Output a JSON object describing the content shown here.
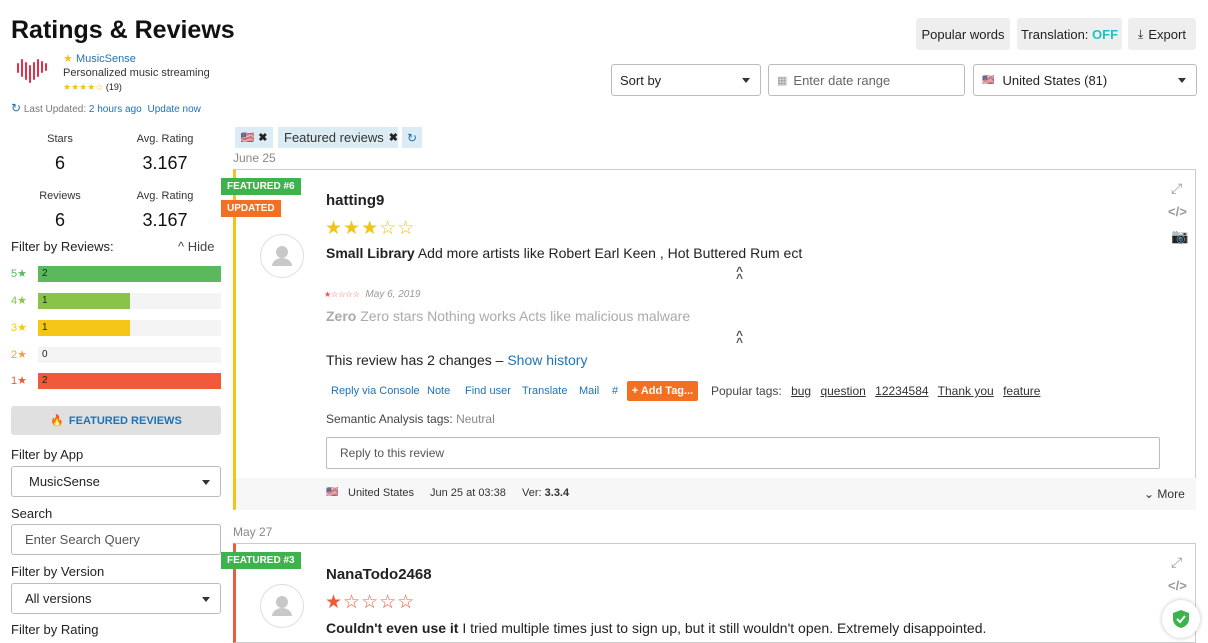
{
  "page": {
    "title": "Ratings & Reviews"
  },
  "app": {
    "name": "MusicSense",
    "subtitle": "Personalized music streaming",
    "stars": "★★★★☆",
    "rating_count": "(19)",
    "last_updated_label": "Last Updated:",
    "last_updated_value": "2 hours ago",
    "update_now": "Update now"
  },
  "toolbar": {
    "popular_words": "Popular words",
    "translation_label": "Translation:",
    "translation_state": "OFF",
    "export": "Export"
  },
  "filters_top": {
    "sort_by": "Sort by",
    "date_placeholder": "Enter date range",
    "country": "United States (81)"
  },
  "chips": {
    "featured": "Featured reviews"
  },
  "stats": {
    "stars_label": "Stars",
    "stars_value": "6",
    "avg1_label": "Avg. Rating",
    "avg1_value": "3.167",
    "reviews_label": "Reviews",
    "reviews_value": "6",
    "avg2_label": "Avg. Rating",
    "avg2_value": "3.167"
  },
  "filter_reviews": {
    "label": "Filter by Reviews:",
    "hide": "Hide",
    "rows": [
      {
        "stars": "5★",
        "count": "2",
        "fraction": 1.0,
        "color": "#5cb85c"
      },
      {
        "stars": "4★",
        "count": "1",
        "fraction": 0.5,
        "color": "#8bc34a"
      },
      {
        "stars": "3★",
        "count": "1",
        "fraction": 0.5,
        "color": "#f5c518"
      },
      {
        "stars": "2★",
        "count": "0",
        "fraction": 0.0,
        "color": "#f4a142"
      },
      {
        "stars": "1★",
        "count": "2",
        "fraction": 1.0,
        "color": "#f05a3a"
      }
    ]
  },
  "sidebar": {
    "featured_button": "FEATURED REVIEWS",
    "filter_app_label": "Filter by App",
    "filter_app_value": "MusicSense",
    "search_label": "Search",
    "search_placeholder": "Enter Search Query",
    "version_label": "Filter by Version",
    "version_value": "All versions",
    "rating_label": "Filter by Rating"
  },
  "reviews": [
    {
      "date_header": "June 25",
      "featured_badge": "FEATURED #6",
      "updated_badge": "UPDATED",
      "author": "hatting9",
      "stars": "★★★☆☆",
      "title": "Small Library",
      "body": "Add more artists like Robert Earl Keen , Hot Buttered Rum ect",
      "old_stars": "★☆☆☆☆",
      "old_date": "May 6, 2019",
      "old_title": "Zero",
      "old_body": "Zero stars Nothing works Acts like malicious malware",
      "changes_text": "This review has 2 changes –",
      "show_history": "Show history",
      "actions": [
        "Reply via Console",
        "Note",
        "Find user",
        "Translate",
        "Mail",
        "#"
      ],
      "add_tag": "+ Add Tag...",
      "popular_tags_label": "Popular tags:",
      "tags": [
        "bug",
        "question",
        "12234584",
        "Thank you",
        "feature"
      ],
      "semantic_label": "Semantic Analysis tags:",
      "semantic_value": "Neutral",
      "reply_placeholder": "Reply to this review",
      "footer_country": "United States",
      "footer_date": "Jun 25 at 03:38",
      "footer_ver_label": "Ver:",
      "footer_ver": "3.3.4",
      "footer_more": "More"
    },
    {
      "date_header": "May 27",
      "featured_badge": "FEATURED #3",
      "author": "NanaTodo2468",
      "stars": "★☆☆☆☆",
      "title": "Couldn't even use it",
      "body": "I tried multiple times just to sign up, but it still wouldn't open. Extremely disappointed."
    }
  ]
}
